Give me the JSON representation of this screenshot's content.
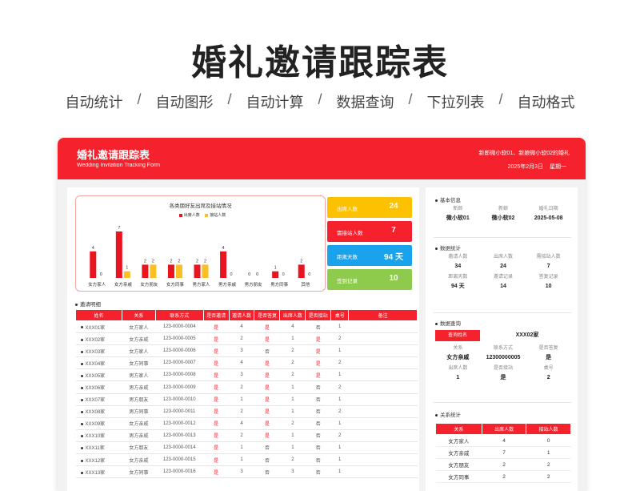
{
  "page": {
    "main_title": "婚礼邀请跟踪表",
    "features": [
      "自动统计",
      "自动图形",
      "自动计算",
      "数据查询",
      "下拉列表",
      "自动格式"
    ],
    "separator": "/"
  },
  "header": {
    "title": "婚礼邀请跟踪表",
    "subtitle": "Wedding Invitation Tracking Form",
    "names": "新郎微小软01、新娘微小软02的婚礼",
    "date": "2025年2月3日",
    "weekday": "星期一"
  },
  "chart_data": {
    "type": "bar",
    "title": "各类朋好友出席及接站情况",
    "categories": [
      "女方家人",
      "女方亲戚",
      "女方朋友",
      "女方同事",
      "男方家人",
      "男方亲戚",
      "男方朋友",
      "男方同事",
      "其他"
    ],
    "series": [
      {
        "name": "出席人数",
        "color": "#e8141f",
        "values": [
          4,
          7,
          2,
          2,
          2,
          4,
          0,
          1,
          2
        ]
      },
      {
        "name": "接站人数",
        "color": "#fbbf24",
        "values": [
          0,
          1,
          2,
          2,
          2,
          0,
          0,
          0,
          0
        ]
      }
    ],
    "ylim": [
      0,
      7
    ]
  },
  "stats": [
    {
      "label": "出席人数",
      "value": "24",
      "color": "#fcc100"
    },
    {
      "label": "需接站人数",
      "value": "7",
      "color": "#f5222d"
    },
    {
      "label": "距离天数",
      "value": "94 天",
      "color": "#1aa3ec"
    },
    {
      "label": "签到记录",
      "value": "10",
      "color": "#8ecb4c"
    }
  ],
  "invite_table": {
    "section_title": "邀请明细",
    "headers": [
      "姓名",
      "关系",
      "联系方式",
      "是否邀请",
      "邀请人数",
      "是否答复",
      "出席人数",
      "是否接站",
      "桌号",
      "备注"
    ],
    "rows": [
      [
        "XXX01家",
        "女方家人",
        "123-0000-0004",
        "是",
        "4",
        "是",
        "4",
        "否",
        "1",
        ""
      ],
      [
        "XXX02家",
        "女方亲戚",
        "123-0000-0005",
        "是",
        "2",
        "是",
        "1",
        "是",
        "2",
        ""
      ],
      [
        "XXX03家",
        "女方家人",
        "123-0000-0006",
        "是",
        "3",
        "否",
        "2",
        "是",
        "1",
        ""
      ],
      [
        "XXX04家",
        "女方同事",
        "123-0000-0007",
        "是",
        "4",
        "是",
        "2",
        "是",
        "2",
        ""
      ],
      [
        "XXX05家",
        "男方家人",
        "123-0000-0008",
        "是",
        "3",
        "是",
        "2",
        "是",
        "1",
        ""
      ],
      [
        "XXX06家",
        "男方亲戚",
        "123-0000-0009",
        "是",
        "2",
        "是",
        "1",
        "否",
        "2",
        ""
      ],
      [
        "XXX07家",
        "男方朋友",
        "123-0000-0010",
        "是",
        "1",
        "是",
        "1",
        "否",
        "1",
        ""
      ],
      [
        "XXX08家",
        "男方同事",
        "123-0000-0011",
        "是",
        "2",
        "是",
        "1",
        "否",
        "2",
        ""
      ],
      [
        "XXX09家",
        "女方亲戚",
        "123-0000-0012",
        "是",
        "4",
        "是",
        "2",
        "否",
        "1",
        ""
      ],
      [
        "XXX10家",
        "男方亲戚",
        "123-0000-0013",
        "是",
        "2",
        "是",
        "1",
        "否",
        "2",
        ""
      ],
      [
        "XXX11家",
        "女方朋友",
        "123-0000-0014",
        "是",
        "1",
        "否",
        "1",
        "否",
        "1",
        ""
      ],
      [
        "XXX12家",
        "女方亲戚",
        "123-0000-0015",
        "是",
        "1",
        "否",
        "2",
        "否",
        "1",
        ""
      ],
      [
        "XXX13家",
        "女方同事",
        "123-0000-0016",
        "是",
        "3",
        "否",
        "3",
        "否",
        "1",
        ""
      ]
    ]
  },
  "basic_info": {
    "title": "基本信息",
    "headers": [
      "新郎",
      "新娘",
      "婚礼日期"
    ],
    "values": [
      "微小软01",
      "微小软02",
      "2025-05-08"
    ]
  },
  "data_stats": {
    "title": "数据统计",
    "headers1": [
      "邀请人数",
      "出席人数",
      "需接站人数"
    ],
    "values1": [
      "34",
      "24",
      "7"
    ],
    "headers2": [
      "距离天数",
      "邀请记录",
      "答复记录"
    ],
    "values2": [
      "94 天",
      "14",
      "10"
    ]
  },
  "data_query": {
    "title": "数据查询",
    "button_label": "查询姓名",
    "query_value": "XXX02家",
    "headers1": [
      "关系",
      "联系方式",
      "是否答复"
    ],
    "values1": [
      "女方亲戚",
      "12300000005",
      "是"
    ],
    "headers2": [
      "出席人数",
      "是否接站",
      "桌号"
    ],
    "values2": [
      "1",
      "是",
      "2"
    ]
  },
  "relation_stats": {
    "title": "关系统计",
    "headers": [
      "关系",
      "出席人数",
      "接站人数"
    ],
    "rows": [
      [
        "女方家人",
        "4",
        "0"
      ],
      [
        "女方亲戚",
        "7",
        "1"
      ],
      [
        "女方朋友",
        "2",
        "2"
      ],
      [
        "女方同事",
        "2",
        "2"
      ]
    ]
  }
}
